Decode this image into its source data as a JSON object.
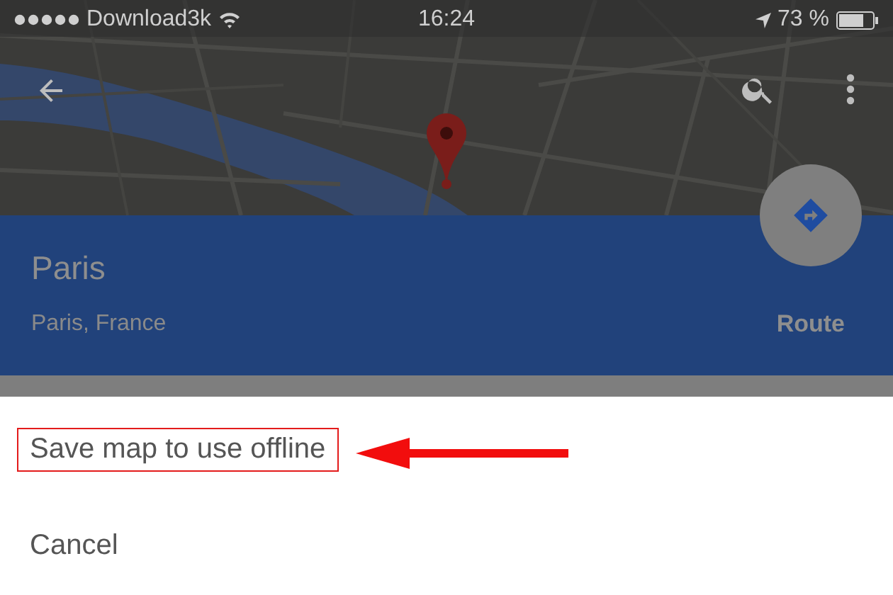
{
  "status_bar": {
    "carrier": "Download3k",
    "time": "16:24",
    "battery": "73 %"
  },
  "place": {
    "name": "Paris",
    "address": "Paris, France",
    "route": "Route"
  },
  "menu": [
    {
      "label": "Save map to use offline",
      "highlighted": true
    },
    {
      "label": "Cancel",
      "highlighted": false
    }
  ]
}
